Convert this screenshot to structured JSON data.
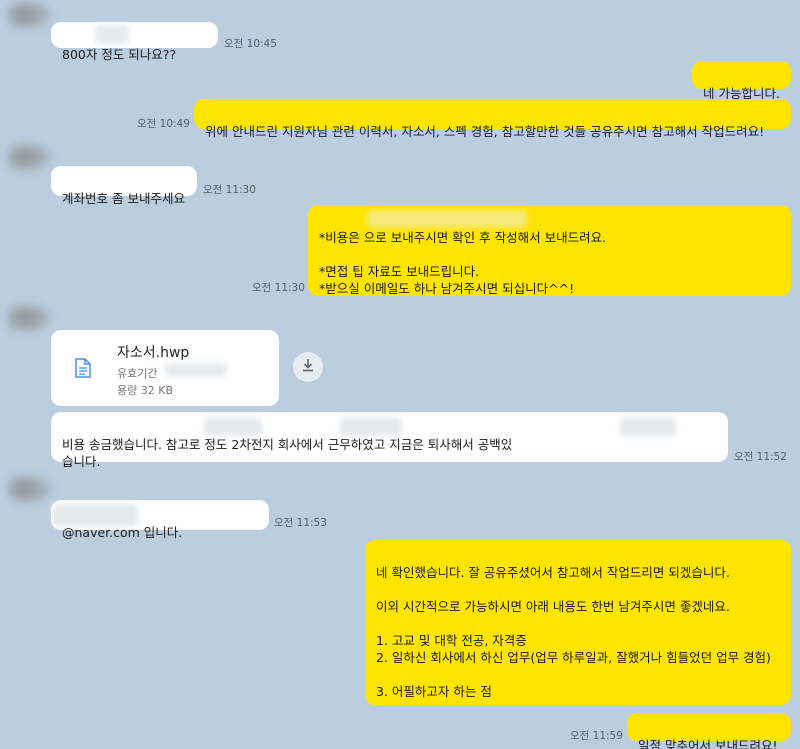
{
  "chat": {
    "messages": [
      {
        "id": "m1",
        "side": "in",
        "text": "800자        정도 되나요??",
        "time": "오전 10:45"
      },
      {
        "id": "m2",
        "side": "out",
        "text": "네 가능합니다.",
        "time": ""
      },
      {
        "id": "m3",
        "side": "out",
        "text": "위에 안내드린 지원자님 관련 이력서, 자소서, 스펙 경험, 참고할만한 것들 공유주시면 참고해서 작업드려요!",
        "time": "오전 10:49"
      },
      {
        "id": "m4",
        "side": "in",
        "text": "계좌번호 좀 보내주세요",
        "time": "오전 11:30"
      },
      {
        "id": "m5",
        "side": "out",
        "text": "*비용은                                                 으로 보내주시면 확인 후 작성해서 보내드려요.\n\n*면접 팁 자료도 보내드립니다.\n*받으실 이메일도 하나 남겨주시면 되십니다^^!",
        "time": "오전 11:30"
      },
      {
        "id": "m7",
        "side": "in",
        "text": "비용 송금했습니다. 참고로                 정도 2차전지                  회사에서 근무하였고 지금은 퇴사해서                  공백있\n습니다.",
        "time": "오전 11:52"
      },
      {
        "id": "m8",
        "side": "in",
        "text": "              @naver.com 입니다.",
        "time": "오전 11:53"
      },
      {
        "id": "m9",
        "side": "out",
        "text": "네 확인했습니다. 잘 공유주셨어서 참고해서 작업드리면 되겠습니다.\n\n이외 시간적으로 가능하시면 아래 내용도 한번 남겨주시면 좋겠네요.\n\n1. 고교 및 대학 전공, 자격증\n2. 일하신 회사에서 하신 업무(업무 하루일과, 잘했거나 힘들었던 업무 경험)\n\n3. 어필하고자 하는 점",
        "time": ""
      },
      {
        "id": "m10",
        "side": "out",
        "text": "일정 맞추어서 보내드려요!",
        "time": "오전 11:59"
      }
    ],
    "file": {
      "name": "자소서.hwp",
      "expiry_label": "유효기간",
      "size": "용량 32 KB",
      "icon": "document-icon",
      "download_icon": "download-icon"
    }
  },
  "colors": {
    "background": "#bacee0",
    "incoming_bubble": "#ffffff",
    "outgoing_bubble": "#fee500",
    "time_text": "#555e66"
  }
}
